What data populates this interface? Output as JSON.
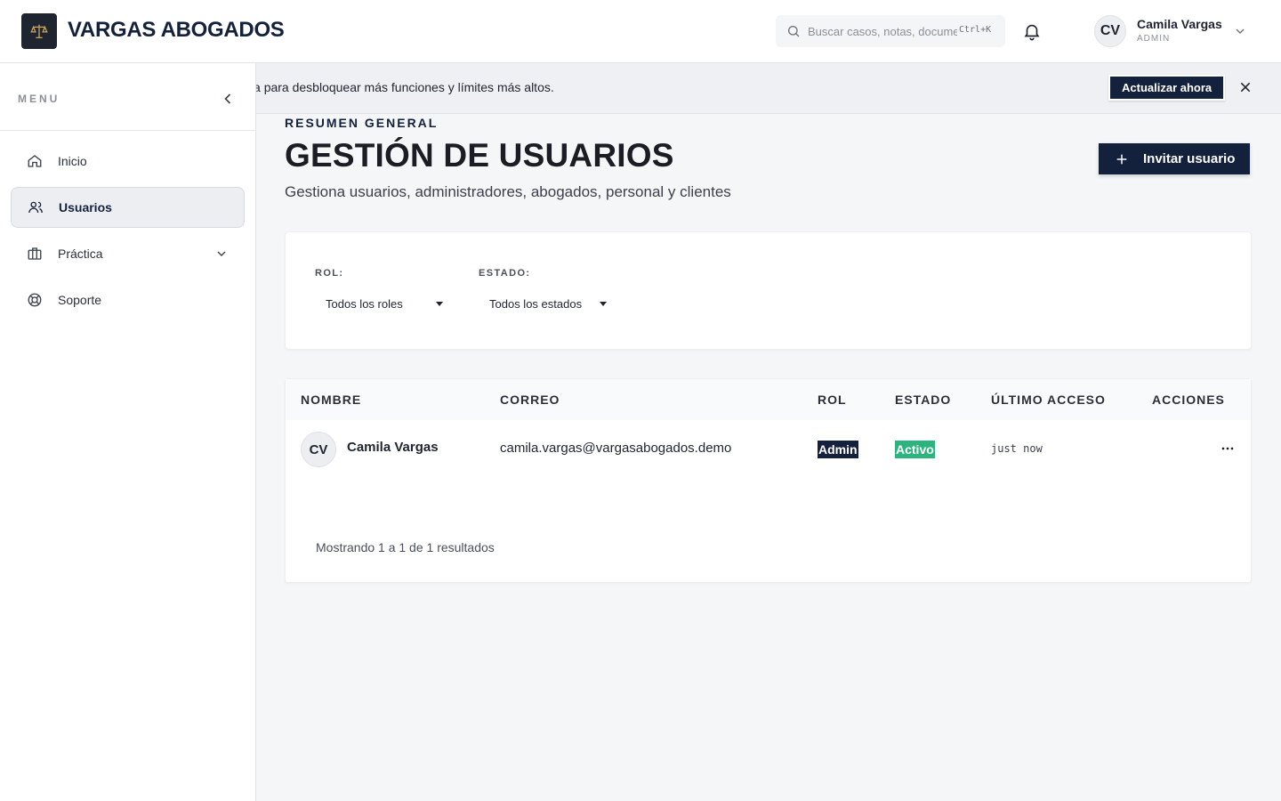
{
  "header": {
    "brand": "VARGAS ABOGADOS",
    "search_placeholder": "Buscar casos, notas, documentos...",
    "search_shortcut": "Ctrl+K",
    "user_initials": "CV",
    "user_name": "Camila Vargas",
    "user_role": "ADMIN"
  },
  "sidebar": {
    "menu_label": "MENU",
    "items": [
      {
        "label": "Inicio",
        "icon": "home-icon"
      },
      {
        "label": "Usuarios",
        "icon": "users-icon",
        "active": true
      },
      {
        "label": "Práctica",
        "icon": "briefcase-icon"
      },
      {
        "label": "Soporte",
        "icon": "lifebuoy-icon"
      }
    ]
  },
  "banner": {
    "text": "Actualiza para desbloquear más funciones y límites más altos.",
    "button": "Actualizar ahora"
  },
  "page": {
    "eyebrow": "RESUMEN GENERAL",
    "title": "GESTIÓN DE USUARIOS",
    "subtitle": "Gestiona usuarios, administradores, abogados, personal y clientes",
    "invite_button": "Invitar usuario"
  },
  "filters": {
    "role_label": "ROL:",
    "role_value": "Todos los roles",
    "status_label": "ESTADO:",
    "status_value": "Todos los estados"
  },
  "table": {
    "columns": [
      "NOMBRE",
      "CORREO",
      "ROL",
      "ESTADO",
      "ÚLTIMO ACCESO",
      "ACCIONES"
    ],
    "rows": [
      {
        "initials": "CV",
        "name": "Camila Vargas",
        "email": "camila.vargas@vargasabogados.demo",
        "role": "Admin",
        "status": "Activo",
        "last_access": "just now"
      }
    ],
    "footer": "Mostrando 1 a 1 de 1 resultados"
  },
  "colors": {
    "primary": "#14213d",
    "active_badge": "#2cb47e"
  }
}
